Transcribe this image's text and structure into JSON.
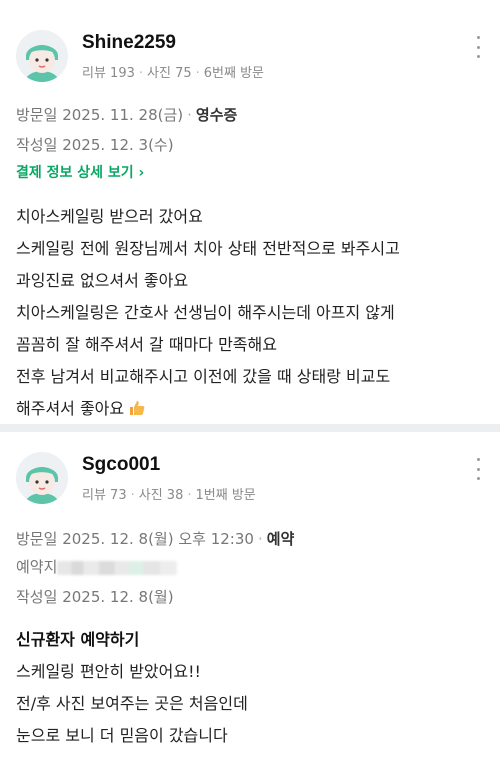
{
  "reviews": [
    {
      "nickname": "Shine2259",
      "meta": [
        "리뷰 193",
        "사진 75",
        "6번째 방문"
      ],
      "visit_label": "방문일",
      "visit_date": "2025. 11. 28(금)",
      "visit_badge": "영수증",
      "written_label": "작성일",
      "written_date": "2025. 12. 3(수)",
      "payment_link": "결제 정보 상세 보기 ›",
      "lines": [
        "치아스케일링 받으러 갔어요",
        "스케일링 전에 원장님께서 치아 상태 전반적으로 봐주시고",
        "과잉진료 없으셔서 좋아요",
        "치아스케일링은 간호사 선생님이 해주시는데 아프지 않게",
        "꼼꼼히 잘 해주셔서 갈 때마다 만족해요",
        "전후 남겨서 비교해주시고 이전에 갔을 때 상태랑 비교도",
        "해주셔서 좋아요"
      ],
      "emoji_icon": "thumbs-up-icon"
    },
    {
      "nickname": "Sgco001",
      "meta": [
        "리뷰 73",
        "사진 38",
        "1번째 방문"
      ],
      "visit_label": "방문일",
      "visit_date": "2025. 12. 8(월) 오후 12:30",
      "visit_badge": "예약",
      "reservation_label": "예약지",
      "written_label": "작성일",
      "written_date": "2025. 12. 8(월)",
      "subtitle": "신규환자 예약하기",
      "lines": [
        "스케일링 편안히 받았어요!!",
        "전/후 사진 보여주는 곳은 처음인데",
        "눈으로 보니 더 믿음이 갔습니다"
      ]
    }
  ],
  "colors": {
    "link_green": "#0aa764",
    "avatar_hair": "#5cc4a8",
    "avatar_face": "#f7e9e3"
  }
}
